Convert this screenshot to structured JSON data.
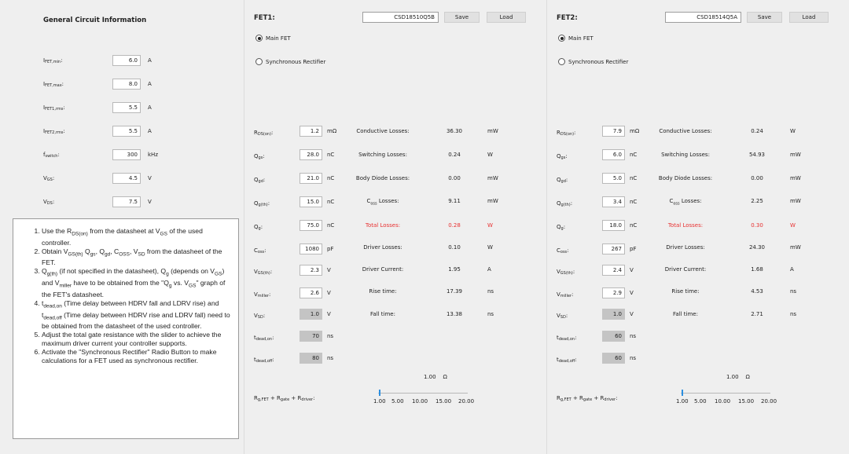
{
  "general": {
    "title": "General Circuit Information",
    "rows": [
      {
        "label_main": "I",
        "label_sub": "FET,min",
        "value": "6.0",
        "unit": "A"
      },
      {
        "label_main": "I",
        "label_sub": "FET,max",
        "value": "8.0",
        "unit": "A"
      },
      {
        "label_main": "I",
        "label_sub": "FET1,rms",
        "value": "5.5",
        "unit": "A"
      },
      {
        "label_main": "I",
        "label_sub": "FET2,rms",
        "value": "5.5",
        "unit": "A"
      },
      {
        "label_main": "f",
        "label_sub": "switch",
        "value": "300",
        "unit": "kHz"
      },
      {
        "label_main": "V",
        "label_sub": "GS",
        "value": "4.5",
        "unit": "V"
      },
      {
        "label_main": "V",
        "label_sub": "DS",
        "value": "7.5",
        "unit": "V"
      }
    ],
    "instructions": [
      [
        "Use the R",
        {
          "sub": "DS(on)"
        },
        " from the datasheet at V",
        {
          "sub": "GS"
        },
        " of the used controller."
      ],
      [
        "Obtain V",
        {
          "sub": "GS(th)"
        },
        " Q",
        {
          "sub": "gs"
        },
        ", Q",
        {
          "sub": "gd"
        },
        ", C",
        {
          "sub": "OSS"
        },
        ", V",
        {
          "sub": "SD"
        },
        " from the datasheet of the FET."
      ],
      [
        "Q",
        {
          "sub": "g(th)"
        },
        " (if not specified in the datasheet), Q",
        {
          "sub": "g"
        },
        " (depends on V",
        {
          "sub": "GS"
        },
        ") and V",
        {
          "sub": "miller"
        },
        " have to be obtained from the \"Q",
        {
          "sub": "g"
        },
        " vs. V",
        {
          "sub": "GS"
        },
        "\" graph of the FET's datasheet."
      ],
      [
        "t",
        {
          "sub": "dead,on"
        },
        " (Time delay between HDRV fall and LDRV rise) and t",
        {
          "sub": "dead,off"
        },
        " (Time delay between HDRV rise and LDRV fall) need to be obtained from the datasheet of the used controller."
      ],
      [
        "Adjust the total gate resistance with the slider to achieve the maximum driver current your controller supports."
      ],
      [
        "Activate the \"Synchronous Rectifier\" Radio Button to make calculations for a FET used as synchronous rectifier."
      ]
    ]
  },
  "fet1": {
    "title": "FET1:",
    "part": "CSD18510Q5B",
    "save_label": "Save",
    "load_label": "Load",
    "radio_main": "Main FET",
    "radio_sync": "Synchronous Rectifier",
    "params": [
      {
        "m": "R",
        "s": "DS(on)",
        "value": "1.2",
        "unit": "mΩ",
        "ro": false
      },
      {
        "m": "Q",
        "s": "gs",
        "value": "28.0",
        "unit": "nC",
        "ro": false
      },
      {
        "m": "Q",
        "s": "gd",
        "value": "21.0",
        "unit": "nC",
        "ro": false
      },
      {
        "m": "Q",
        "s": "g(th)",
        "value": "15.0",
        "unit": "nC",
        "ro": false
      },
      {
        "m": "Q",
        "s": "g",
        "value": "75.0",
        "unit": "nC",
        "ro": false
      },
      {
        "m": "C",
        "s": "oss",
        "value": "1080",
        "unit": "pF",
        "ro": false
      },
      {
        "m": "V",
        "s": "GS(th)",
        "value": "2.3",
        "unit": "V",
        "ro": false
      },
      {
        "m": "V",
        "s": "miller",
        "value": "2.6",
        "unit": "V",
        "ro": false
      },
      {
        "m": "V",
        "s": "SD",
        "value": "1.0",
        "unit": "V",
        "ro": true
      },
      {
        "m": "t",
        "s": "dead,on",
        "value": "70",
        "unit": "ns",
        "ro": true
      },
      {
        "m": "t",
        "s": "dead,off",
        "value": "80",
        "unit": "ns",
        "ro": true
      }
    ],
    "results": [
      {
        "label": "Conductive Losses:",
        "value": "36.30",
        "unit": "mW",
        "red": false
      },
      {
        "label": "Switching Losses:",
        "value": "0.24",
        "unit": "W",
        "red": false
      },
      {
        "label": "Body Diode Losses:",
        "value": "0.00",
        "unit": "mW",
        "red": false
      },
      {
        "label": "C",
        "label_sub": "oss",
        "label_tail": " Losses:",
        "value": "9.11",
        "unit": "mW",
        "red": false
      },
      {
        "label": "Total Losses:",
        "value": "0.28",
        "unit": "W",
        "red": true
      },
      {
        "label": "Driver Losses:",
        "value": "0.10",
        "unit": "W",
        "red": false
      },
      {
        "label": "Driver Current:",
        "value": "1.95",
        "unit": "A",
        "red": false
      },
      {
        "label": "Rise time:",
        "value": "17.39",
        "unit": "ns",
        "red": false
      },
      {
        "label": "Fall time:",
        "value": "13.38",
        "unit": "ns",
        "red": false
      }
    ],
    "slider_value": "1.00",
    "slider_unit": "Ω",
    "slider_ticks": [
      "1.00",
      "5.00",
      "10.00",
      "15.00",
      "20.00"
    ],
    "slider_fraction": 0.0
  },
  "fet2": {
    "title": "FET2:",
    "part": "CSD18514Q5A",
    "save_label": "Save",
    "load_label": "Load",
    "radio_main": "Main FET",
    "radio_sync": "Synchronous Rectifier",
    "params": [
      {
        "m": "R",
        "s": "DS(on)",
        "value": "7.9",
        "unit": "mΩ",
        "ro": false
      },
      {
        "m": "Q",
        "s": "gs",
        "value": "6.0",
        "unit": "nC",
        "ro": false
      },
      {
        "m": "Q",
        "s": "gd",
        "value": "5.0",
        "unit": "nC",
        "ro": false
      },
      {
        "m": "Q",
        "s": "g(th)",
        "value": "3.4",
        "unit": "nC",
        "ro": false
      },
      {
        "m": "Q",
        "s": "g",
        "value": "18.0",
        "unit": "nC",
        "ro": false
      },
      {
        "m": "C",
        "s": "oss",
        "value": "267",
        "unit": "pF",
        "ro": false
      },
      {
        "m": "V",
        "s": "GS(th)",
        "value": "2.4",
        "unit": "V",
        "ro": false
      },
      {
        "m": "V",
        "s": "miller",
        "value": "2.9",
        "unit": "V",
        "ro": false
      },
      {
        "m": "V",
        "s": "SD",
        "value": "1.0",
        "unit": "V",
        "ro": true
      },
      {
        "m": "t",
        "s": "dead,on",
        "value": "60",
        "unit": "ns",
        "ro": true
      },
      {
        "m": "t",
        "s": "dead,off",
        "value": "60",
        "unit": "ns",
        "ro": true
      }
    ],
    "results": [
      {
        "label": "Conductive Losses:",
        "value": "0.24",
        "unit": "W",
        "red": false
      },
      {
        "label": "Switching Losses:",
        "value": "54.93",
        "unit": "mW",
        "red": false
      },
      {
        "label": "Body Diode Losses:",
        "value": "0.00",
        "unit": "mW",
        "red": false
      },
      {
        "label": "C",
        "label_sub": "oss",
        "label_tail": " Losses:",
        "value": "2.25",
        "unit": "mW",
        "red": false
      },
      {
        "label": "Total Losses:",
        "value": "0.30",
        "unit": "W",
        "red": true
      },
      {
        "label": "Driver Losses:",
        "value": "24.30",
        "unit": "mW",
        "red": false
      },
      {
        "label": "Driver Current:",
        "value": "1.68",
        "unit": "A",
        "red": false
      },
      {
        "label": "Rise time:",
        "value": "4.53",
        "unit": "ns",
        "red": false
      },
      {
        "label": "Fall time:",
        "value": "2.71",
        "unit": "ns",
        "red": false
      }
    ],
    "slider_value": "1.00",
    "slider_unit": "Ω",
    "slider_ticks": [
      "1.00",
      "5.00",
      "10.00",
      "15.00",
      "20.00"
    ],
    "slider_fraction": 0.0
  },
  "gate_label": {
    "r1": "R",
    "s1": "g,FET",
    "r2": " + R",
    "s2": "gate",
    "r3": " + R",
    "s3": "driver",
    "tail": ":"
  },
  "colors": {
    "total_losses": "#e83030",
    "slider_thumb": "#2b8fe0",
    "readonly_field": "#c4c4c4"
  }
}
